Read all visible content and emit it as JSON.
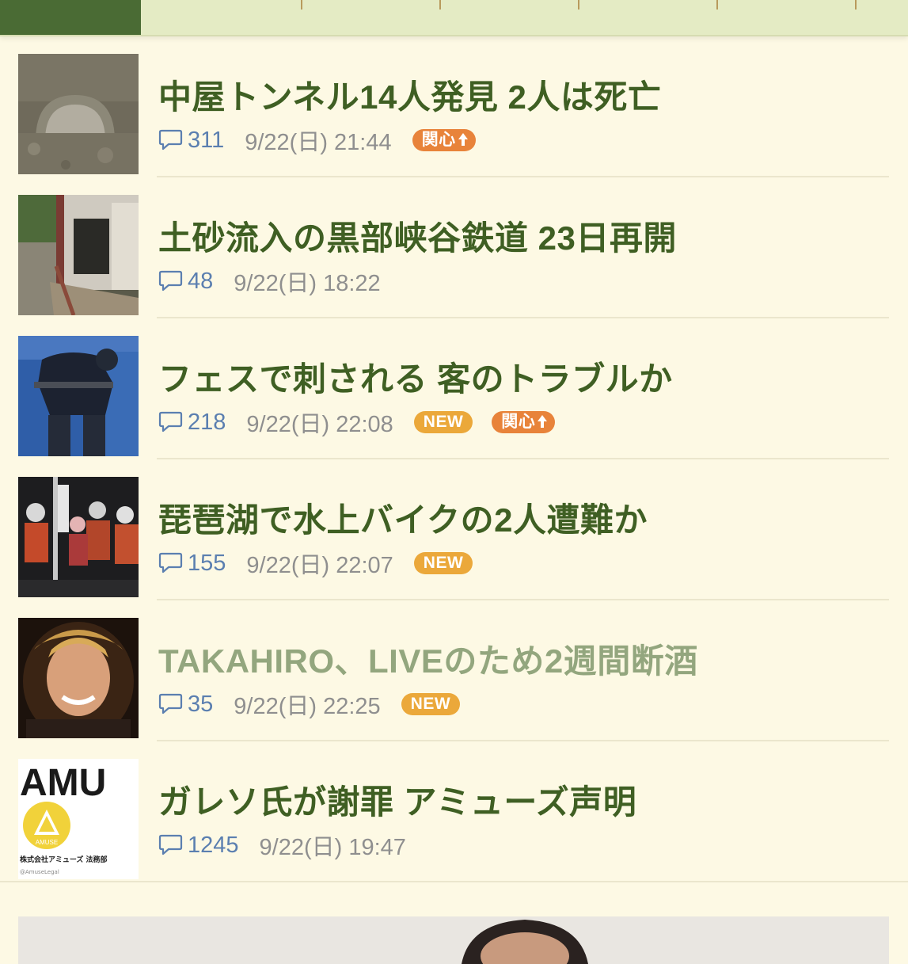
{
  "tabs": {
    "active_label": "",
    "items": [
      {
        "label": ""
      },
      {
        "label": ""
      },
      {
        "label": ""
      },
      {
        "label": ""
      },
      {
        "label": ""
      }
    ]
  },
  "colors": {
    "title": "#3f5f23",
    "title_visited": "#93a67e",
    "comment_count": "#5b7fb0",
    "badge_new": "#eba83a",
    "badge_interest": "#e8833a",
    "tab_active": "#4a6b34",
    "tab_bar": "#e4ebc4",
    "background": "#fdf9e4"
  },
  "articles": [
    {
      "title": "中屋トンネル14人発見 2人は死亡",
      "comments": "311",
      "date": "9/22(日) 21:44",
      "badges": [
        "interest"
      ],
      "visited": false,
      "thumb_icon": "tunnel-photo"
    },
    {
      "title": "土砂流入の黒部峡谷鉄道 23日再開",
      "comments": "48",
      "date": "9/22(日) 18:22",
      "badges": [],
      "visited": false,
      "thumb_icon": "railway-photo"
    },
    {
      "title": "フェスで刺される 客のトラブルか",
      "comments": "218",
      "date": "9/22(日) 22:08",
      "badges": [
        "new",
        "interest"
      ],
      "visited": false,
      "thumb_icon": "police-photo"
    },
    {
      "title": "琵琶湖で水上バイクの2人遭難か",
      "comments": "155",
      "date": "9/22(日) 22:07",
      "badges": [
        "new"
      ],
      "visited": false,
      "thumb_icon": "rescue-photo"
    },
    {
      "title": "TAKAHIRO、LIVEのため2週間断酒",
      "comments": "35",
      "date": "9/22(日) 22:25",
      "badges": [
        "new"
      ],
      "visited": true,
      "thumb_icon": "portrait-photo"
    },
    {
      "title": "ガレソ氏が謝罪 アミューズ声明",
      "comments": "1245",
      "date": "9/22(日) 19:47",
      "badges": [],
      "visited": false,
      "thumb_icon": "amuse-logo"
    }
  ],
  "badge_labels": {
    "new": "NEW",
    "interest": "関心"
  },
  "thumb_amuse": {
    "logo_text": "AMU",
    "badge_text": "AMUSE",
    "caption": "株式会社アミューズ 法務部",
    "handle": "@AmuseLegal"
  }
}
